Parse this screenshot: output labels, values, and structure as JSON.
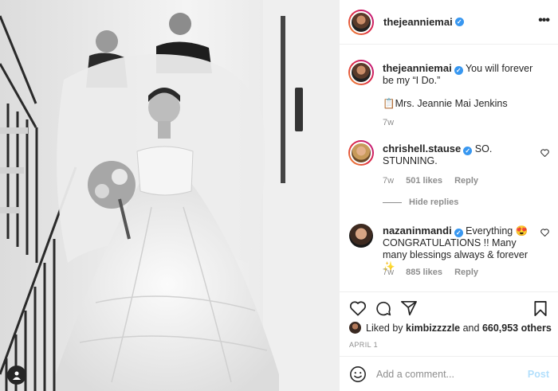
{
  "header": {
    "username": "thejeanniemai",
    "verified": true,
    "more_icon": "more-horizontal-icon"
  },
  "caption": {
    "username": "thejeanniemai",
    "text": "You will forever be my “I Do.”",
    "text2": "📋Mrs. Jeannie Mai Jenkins",
    "age": "7w"
  },
  "comments": [
    {
      "username": "chrishell.stause",
      "text": "SO. STUNNING.",
      "age": "7w",
      "likes": "501 likes",
      "reply_label": "Reply"
    },
    {
      "username": "nazaninmandi",
      "text": "Everything 😍 CONGRATULATIONS !! Many many blessings always & forever ✨",
      "age": "7w",
      "likes": "885 likes",
      "reply_label": "Reply"
    }
  ],
  "hide_replies_label": "Hide replies",
  "likes_line": {
    "prefix": "Liked by",
    "user": "kimbizzzzle",
    "middle": "and",
    "count": "660,953 others"
  },
  "date": "APRIL 1",
  "add_comment": {
    "placeholder": "Add a comment...",
    "post_label": "Post"
  },
  "colors": {
    "verified_blue": "#3897f0",
    "post_disabled": "#b2dffc",
    "secondary_text": "#8e8e8e"
  }
}
